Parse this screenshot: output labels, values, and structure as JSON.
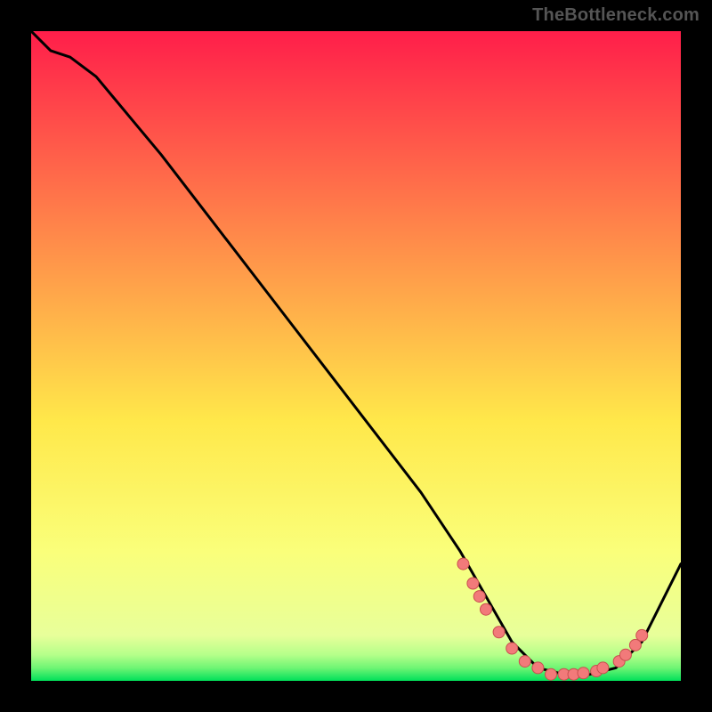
{
  "attribution": "TheBottleneck.com",
  "colors": {
    "frame": "#000000",
    "gradient_top": "#FF1E4A",
    "gradient_mid_up": "#FF844A",
    "gradient_mid": "#FFE84A",
    "gradient_low": "#FAFF7A",
    "gradient_base": "#00E05A",
    "curve": "#000000",
    "dot_fill": "#F27A7A",
    "dot_stroke": "#C94F4F"
  },
  "chart_data": {
    "type": "line",
    "title": "",
    "xlabel": "",
    "ylabel": "",
    "xlim": [
      0,
      100
    ],
    "ylim": [
      0,
      100
    ],
    "curve": {
      "x": [
        0,
        3,
        6,
        10,
        15,
        20,
        30,
        40,
        50,
        60,
        66,
        70,
        74,
        78,
        82,
        86,
        90,
        94,
        100
      ],
      "y": [
        100,
        97,
        96,
        93,
        87,
        81,
        68,
        55,
        42,
        29,
        20,
        13,
        6,
        2,
        1,
        1,
        2,
        6,
        18
      ]
    },
    "dots": {
      "x": [
        66.5,
        68,
        69,
        70,
        72,
        74,
        76,
        78,
        80,
        82,
        83.5,
        85,
        87,
        88,
        90.5,
        91.5,
        93,
        94
      ],
      "y": [
        18,
        15,
        13,
        11,
        7.5,
        5,
        3,
        2,
        1,
        1,
        1,
        1.2,
        1.5,
        2,
        3,
        4,
        5.5,
        7
      ]
    }
  }
}
